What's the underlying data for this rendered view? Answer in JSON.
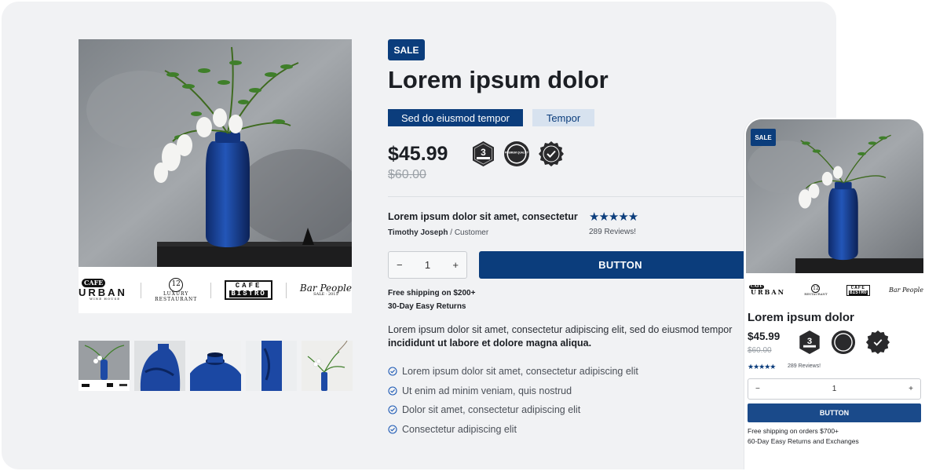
{
  "desktop": {
    "sale_badge": "SALE",
    "title": "Lorem ipsum dolor",
    "tags": [
      "Sed do eiusmod tempor",
      "Tempor"
    ],
    "price": "$45.99",
    "old_price": "$60.00",
    "trust_badges": [
      {
        "icon": "3-year-warranty-badge-icon",
        "text": "3"
      },
      {
        "icon": "premium-quality-badge-icon",
        "text": "PREMIUM QUALITY"
      },
      {
        "icon": "verified-check-badge-icon",
        "text": ""
      }
    ],
    "partner_logos": [
      {
        "top": "CAFE",
        "bottom": "URBAN",
        "sub": "WINE HOUSE"
      },
      {
        "top": "12",
        "bottom": "LUXURY",
        "sub": "RESTAURANT"
      },
      {
        "top": "CAFE",
        "bottom": "BISTRO",
        "sub": ""
      },
      {
        "top": "Bar People",
        "bottom": "",
        "sub": "SALE · 2015"
      }
    ],
    "review": {
      "title": "Lorem ipsum dolor sit amet, consectetur",
      "author": "Timothy Joseph",
      "role": " / Customer",
      "stars": "★★★★★",
      "count": "289 Reviews!"
    },
    "quantity": {
      "minus": "−",
      "value": "1",
      "plus": "+"
    },
    "button": "BUTTON",
    "shipping_line1": "Free shipping on $200+",
    "shipping_line2": "30-Day Easy Returns",
    "description": "Lorem ipsum dolor sit amet, consectetur adipiscing elit, sed do eiusmod tempor",
    "description_bold": "incididunt ut labore et dolore magna aliqua.",
    "features": [
      "Lorem ipsum dolor sit amet, consectetur adipiscing elit",
      "Ut enim ad minim veniam, quis nostrud",
      "Dolor sit amet, consectetur adipiscing elit",
      "Consectetur adipiscing elit"
    ]
  },
  "mobile": {
    "sale_badge": "SALE",
    "title": "Lorem ipsum dolor",
    "price": "$45.99",
    "old_price": "$60.00",
    "stars": "★★★★★",
    "reviews": "289 Reviews!",
    "quantity": {
      "minus": "−",
      "value": "1",
      "plus": "+"
    },
    "button": "BUTTON",
    "shipping_line1": "Free shipping on orders $700+",
    "shipping_line2": "60-Day Easy Returns and Exchanges"
  },
  "colors": {
    "brand": "#0b3d7c",
    "tag_light": "#d7e2ef",
    "panel": "#f1f2f4"
  }
}
